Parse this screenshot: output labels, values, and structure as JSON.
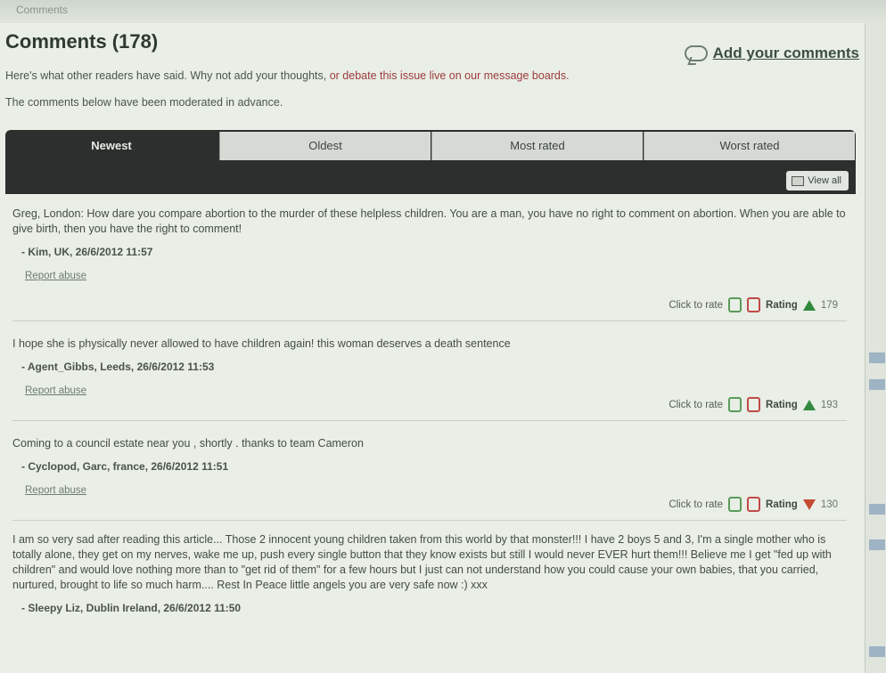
{
  "page": {
    "header_strip": "Comments",
    "title": "Comments (178)",
    "add_comments_label": "Add your comments",
    "intro_text_part1": "Here's what other readers have said. Why not add your thoughts,",
    "intro_text_part2": " or debate this issue live on our message boards.",
    "moderated_text": "The comments below have been moderated in advance.",
    "view_all_label": "View all"
  },
  "tabs": [
    {
      "label": "Newest",
      "active": true
    },
    {
      "label": "Oldest",
      "active": false
    },
    {
      "label": "Most rated",
      "active": false
    },
    {
      "label": "Worst rated",
      "active": false
    }
  ],
  "comments": [
    {
      "body": "Greg, London: How dare you compare abortion to the murder of these helpless children. You are a man, you have no right to comment on abortion. When you are able to give birth, then you have the right to comment!",
      "author": "- Kim, UK, 26/6/2012 11:57",
      "report": "Report abuse",
      "click_to_rate": "Click to rate",
      "rating_label": "Rating",
      "rating_value": "179",
      "rating_direction": "up"
    },
    {
      "body": "I hope she is physically never allowed to have children again! this woman deserves a death sentence",
      "author": "- Agent_Gibbs, Leeds, 26/6/2012 11:53",
      "report": "Report abuse",
      "click_to_rate": "Click to rate",
      "rating_label": "Rating",
      "rating_value": "193",
      "rating_direction": "up"
    },
    {
      "body": "Coming to a council estate near you , shortly . thanks to team Cameron",
      "author": "- Cyclopod, Garc, france, 26/6/2012 11:51",
      "report": "Report abuse",
      "click_to_rate": "Click to rate",
      "rating_label": "Rating",
      "rating_value": "130",
      "rating_direction": "down"
    },
    {
      "body": "I am so very sad after reading this article... Those 2 innocent young children taken from this world by that monster!!! I have 2 boys 5 and 3, I'm a single mother who is totally alone, they get on my nerves, wake me up, push every single button that they know exists but still I would never EVER hurt them!!! Believe me I get \"fed up with children\" and would love nothing more than to \"get rid of them\" for a few hours but I just can not understand how you could cause your own babies, that you carried, nurtured, brought to life so much harm.... Rest In Peace little angels you are very safe now :) xxx",
      "author": "- Sleepy Liz, Dublin Ireland, 26/6/2012 11:50"
    }
  ],
  "colors": {
    "tab_dark": "#2b2f2d",
    "debate_link": "#9c3b3b",
    "rating_up": "#2f8a3f",
    "rating_down": "#c44a34"
  }
}
